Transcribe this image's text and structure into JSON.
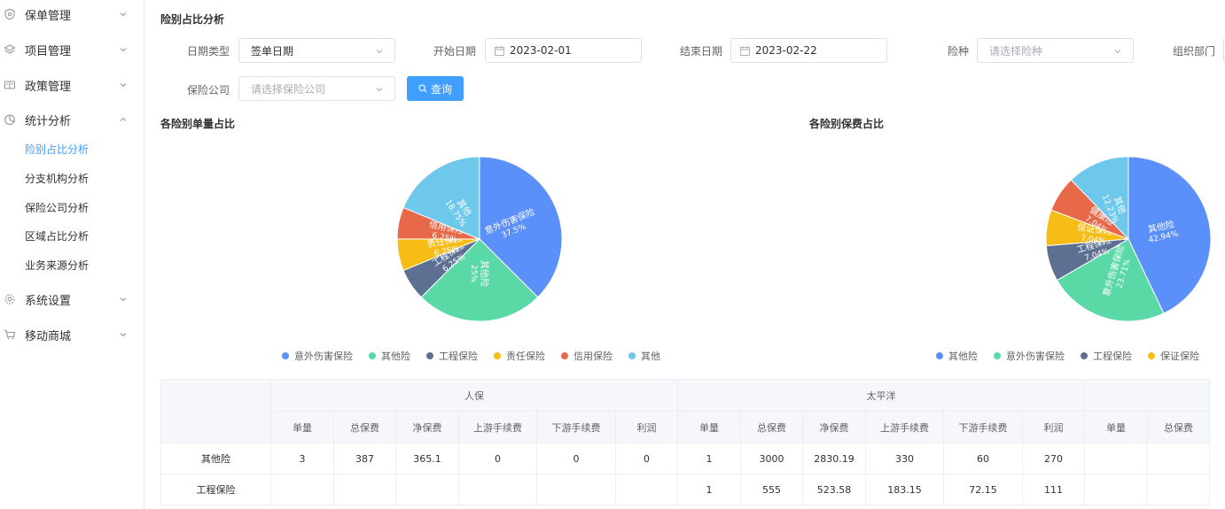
{
  "sidebar": {
    "items": [
      {
        "label": "保单管理",
        "icon": "shield-icon"
      },
      {
        "label": "项目管理",
        "icon": "layers-icon"
      },
      {
        "label": "政策管理",
        "icon": "policy-icon"
      },
      {
        "label": "统计分析",
        "icon": "pie-chart-icon",
        "expanded": true,
        "children": [
          "险别占比分析",
          "分支机构分析",
          "保险公司分析",
          "区域占比分析",
          "业务来源分析"
        ],
        "active_child": "险别占比分析"
      },
      {
        "label": "系统设置",
        "icon": "gear-icon"
      },
      {
        "label": "移动商城",
        "icon": "cart-icon"
      }
    ]
  },
  "page": {
    "title": "险别占比分析"
  },
  "filters": {
    "date_type": {
      "label": "日期类型",
      "value": "签单日期"
    },
    "start_date": {
      "label": "开始日期",
      "value": "2023-02-01"
    },
    "end_date": {
      "label": "结束日期",
      "value": "2023-02-22"
    },
    "insurance_type": {
      "label": "险种",
      "placeholder": "请选择险种"
    },
    "department": {
      "label": "组织部门"
    },
    "company": {
      "label": "保险公司",
      "placeholder": "请选择保险公司"
    },
    "query_label": "查询"
  },
  "colors": {
    "accent": "#409eff",
    "series": [
      "#5b8ff9",
      "#5ad8a6",
      "#5d7092",
      "#f6bd16",
      "#e8684a",
      "#6dc8ec"
    ]
  },
  "chart_data": [
    {
      "type": "pie",
      "title": "各险别单量占比",
      "categories": [
        "意外伤害保险",
        "其他险",
        "工程保险",
        "责任保险",
        "信用保险",
        "其他"
      ],
      "values": [
        37.5,
        25,
        6.25,
        6.25,
        6.25,
        18.75
      ],
      "labels": [
        "37.5%",
        "25%",
        "6.25%",
        "6.25%",
        "6.25%",
        "18.75%"
      ],
      "legend_position": "bottom"
    },
    {
      "type": "pie",
      "title": "各险别保费占比",
      "categories": [
        "其他险",
        "意外伤害保险",
        "工程保险",
        "保证保险",
        "健康险",
        "其他"
      ],
      "values": [
        42.94,
        23.71,
        7.04,
        7.04,
        7.04,
        12.23
      ],
      "labels": [
        "42.94%",
        "23.71%",
        "7.04%",
        "7.04%",
        "7.04%",
        "12.23%"
      ],
      "legend_visible": [
        "其他险",
        "意外伤害保险",
        "工程保险",
        "保证保险"
      ],
      "legend_position": "bottom"
    }
  ],
  "table": {
    "groups": [
      "人保",
      "太平洋"
    ],
    "columns": [
      "单量",
      "总保费",
      "净保费",
      "上游手续费",
      "下游手续费",
      "利润"
    ],
    "extra_columns": [
      "单量",
      "总保费"
    ],
    "rows": [
      {
        "name": "其他险",
        "cells": [
          "3",
          "387",
          "365.1",
          "0",
          "0",
          "0",
          "1",
          "3000",
          "2830.19",
          "330",
          "60",
          "270",
          "",
          ""
        ]
      },
      {
        "name": "工程保险",
        "cells": [
          "",
          "",
          "",
          "",
          "",
          "",
          "1",
          "555",
          "523.58",
          "183.15",
          "72.15",
          "111",
          "",
          ""
        ]
      }
    ]
  }
}
